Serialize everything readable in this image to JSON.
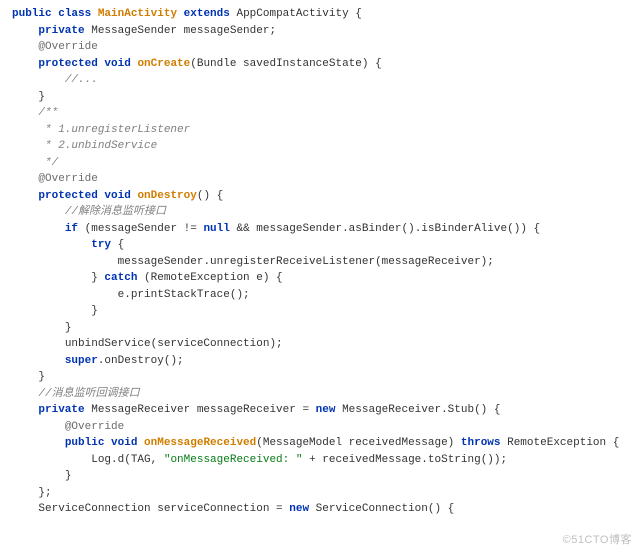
{
  "watermark": "©51CTO博客",
  "lines": [
    {
      "indent": 0,
      "tokens": [
        {
          "t": "public ",
          "c": "kw"
        },
        {
          "t": "class ",
          "c": "kw"
        },
        {
          "t": "MainActivity",
          "c": "meth"
        },
        {
          "t": " ",
          "c": "plain"
        },
        {
          "t": "extends ",
          "c": "kw"
        },
        {
          "t": "AppCompatActivity {",
          "c": "plain"
        }
      ]
    },
    {
      "indent": 1,
      "tokens": [
        {
          "t": "private ",
          "c": "kw"
        },
        {
          "t": "MessageSender messageSender;",
          "c": "plain"
        }
      ]
    },
    {
      "indent": 1,
      "tokens": [
        {
          "t": "@Override",
          "c": "ann"
        }
      ]
    },
    {
      "indent": 1,
      "tokens": [
        {
          "t": "protected void ",
          "c": "kw"
        },
        {
          "t": "onCreate",
          "c": "meth"
        },
        {
          "t": "(Bundle savedInstanceState) {",
          "c": "plain"
        }
      ]
    },
    {
      "indent": 2,
      "tokens": [
        {
          "t": "//...",
          "c": "cmt"
        }
      ]
    },
    {
      "indent": 1,
      "tokens": [
        {
          "t": "}",
          "c": "plain"
        }
      ]
    },
    {
      "indent": 1,
      "tokens": [
        {
          "t": "/**",
          "c": "cmt"
        }
      ]
    },
    {
      "indent": 1,
      "tokens": [
        {
          "t": " * 1.unregisterListener",
          "c": "cmt"
        }
      ]
    },
    {
      "indent": 1,
      "tokens": [
        {
          "t": " * 2.unbindService",
          "c": "cmt"
        }
      ]
    },
    {
      "indent": 1,
      "tokens": [
        {
          "t": " */",
          "c": "cmt"
        }
      ]
    },
    {
      "indent": 1,
      "tokens": [
        {
          "t": "@Override",
          "c": "ann"
        }
      ]
    },
    {
      "indent": 1,
      "tokens": [
        {
          "t": "protected void ",
          "c": "kw"
        },
        {
          "t": "onDestroy",
          "c": "meth"
        },
        {
          "t": "() {",
          "c": "plain"
        }
      ]
    },
    {
      "indent": 2,
      "tokens": [
        {
          "t": "//解除消息监听接口",
          "c": "cmt"
        }
      ]
    },
    {
      "indent": 2,
      "tokens": [
        {
          "t": "if ",
          "c": "kw"
        },
        {
          "t": "(messageSender != ",
          "c": "plain"
        },
        {
          "t": "null ",
          "c": "kw"
        },
        {
          "t": "&& messageSender.asBinder().isBinderAlive()) {",
          "c": "plain"
        }
      ]
    },
    {
      "indent": 3,
      "tokens": [
        {
          "t": "try ",
          "c": "kw"
        },
        {
          "t": "{",
          "c": "plain"
        }
      ]
    },
    {
      "indent": 4,
      "tokens": [
        {
          "t": "messageSender.unregisterReceiveListener(messageReceiver);",
          "c": "plain"
        }
      ]
    },
    {
      "indent": 3,
      "tokens": [
        {
          "t": "} ",
          "c": "plain"
        },
        {
          "t": "catch ",
          "c": "kw"
        },
        {
          "t": "(RemoteException e) {",
          "c": "plain"
        }
      ]
    },
    {
      "indent": 4,
      "tokens": [
        {
          "t": "e.printStackTrace();",
          "c": "plain"
        }
      ]
    },
    {
      "indent": 3,
      "tokens": [
        {
          "t": "}",
          "c": "plain"
        }
      ]
    },
    {
      "indent": 2,
      "tokens": [
        {
          "t": "}",
          "c": "plain"
        }
      ]
    },
    {
      "indent": 2,
      "tokens": [
        {
          "t": "unbindService(serviceConnection);",
          "c": "plain"
        }
      ]
    },
    {
      "indent": 2,
      "tokens": [
        {
          "t": "super",
          "c": "kw"
        },
        {
          "t": ".onDestroy();",
          "c": "plain"
        }
      ]
    },
    {
      "indent": 1,
      "tokens": [
        {
          "t": "}",
          "c": "plain"
        }
      ]
    },
    {
      "indent": 1,
      "tokens": [
        {
          "t": "//消息监听回调接口",
          "c": "cmt"
        }
      ]
    },
    {
      "indent": 1,
      "tokens": [
        {
          "t": "private ",
          "c": "kw"
        },
        {
          "t": "MessageReceiver messageReceiver = ",
          "c": "plain"
        },
        {
          "t": "new ",
          "c": "kw"
        },
        {
          "t": "MessageReceiver.Stub() {",
          "c": "plain"
        }
      ]
    },
    {
      "indent": 2,
      "tokens": [
        {
          "t": "@Override",
          "c": "ann"
        }
      ]
    },
    {
      "indent": 2,
      "tokens": [
        {
          "t": "public void ",
          "c": "kw"
        },
        {
          "t": "onMessageReceived",
          "c": "meth"
        },
        {
          "t": "(MessageModel receivedMessage) ",
          "c": "plain"
        },
        {
          "t": "throws ",
          "c": "kw"
        },
        {
          "t": "RemoteException {",
          "c": "plain"
        }
      ]
    },
    {
      "indent": 3,
      "tokens": [
        {
          "t": "Log.d(TAG, ",
          "c": "plain"
        },
        {
          "t": "\"onMessageReceived: \"",
          "c": "str"
        },
        {
          "t": " + receivedMessage.toString());",
          "c": "plain"
        }
      ]
    },
    {
      "indent": 2,
      "tokens": [
        {
          "t": "}",
          "c": "plain"
        }
      ]
    },
    {
      "indent": 1,
      "tokens": [
        {
          "t": "};",
          "c": "plain"
        }
      ]
    },
    {
      "indent": 1,
      "tokens": [
        {
          "t": "ServiceConnection serviceConnection = ",
          "c": "plain"
        },
        {
          "t": "new ",
          "c": "kw"
        },
        {
          "t": "ServiceConnection() {",
          "c": "plain"
        }
      ]
    }
  ]
}
